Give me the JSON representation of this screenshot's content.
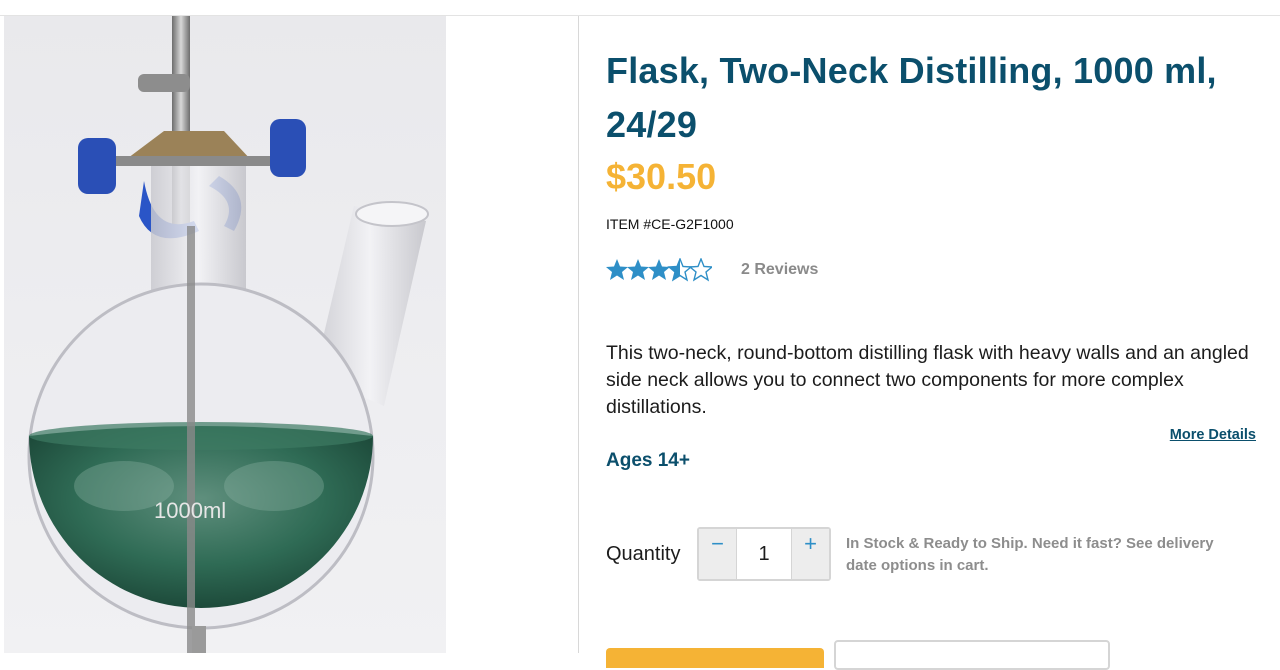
{
  "product": {
    "title": "Flask, Two-Neck Distilling, 1000 ml, 24/29",
    "price": "$30.50",
    "item_number": "ITEM #CE-G2F1000",
    "rating": 3.5,
    "rating_max": 5,
    "reviews_label": "2 Reviews",
    "description": "This two-neck, round-bottom distilling flask with heavy walls and an angled side neck allows you to connect two components for more complex distillations.",
    "more_details_label": "More Details",
    "ages": "Ages 14+"
  },
  "image": {
    "flask_marking": "1000ml"
  },
  "purchase": {
    "quantity_label": "Quantity",
    "quantity_value": "1",
    "decrement_label": "−",
    "increment_label": "+",
    "stock_message": "In Stock & Ready to Ship. Need it fast? See delivery date options in cart."
  },
  "colors": {
    "title": "#0b4f6c",
    "price": "#f5b335",
    "accent": "#2e8fc7",
    "liquid": "#2f6b55"
  },
  "icons": {
    "star_full": "star-full-icon",
    "star_empty": "star-empty-icon"
  }
}
